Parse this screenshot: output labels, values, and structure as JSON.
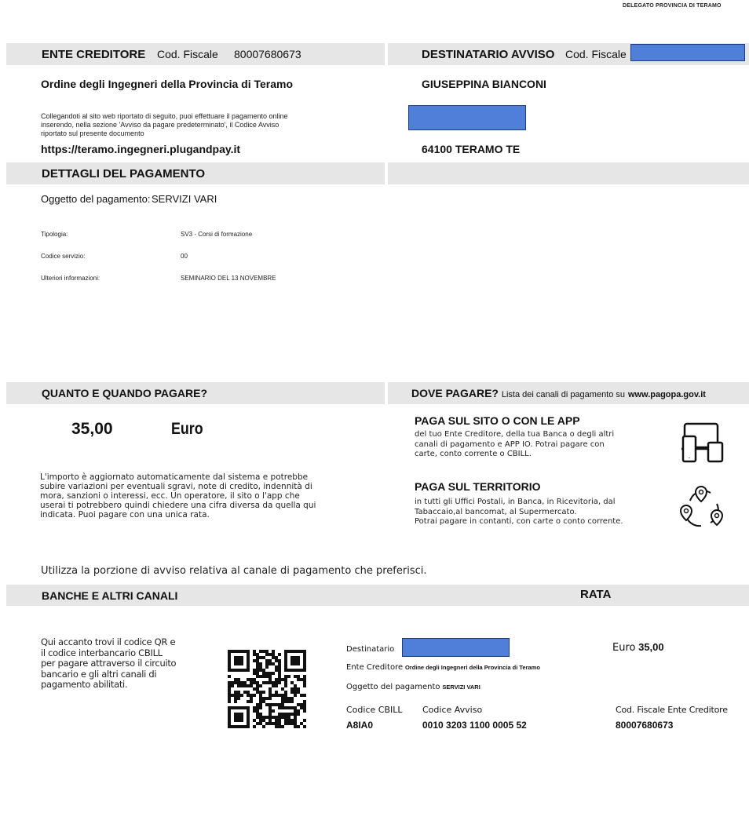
{
  "top_right_text": "DELEGATO PROVINCIA DI TERAMO",
  "creditor": {
    "header": "ENTE CREDITORE",
    "cf_label": "Cod. Fiscale",
    "cf_value": "80007680673",
    "name": "Ordine degli Ingegneri della Provincia di Teramo",
    "instructions_line1": "Collegandoti al sito web riportato di seguito, puoi effettuare il pagamento online",
    "instructions_line2": "inserendo, nella sezione 'Avviso da pagare predeterminato', il Codice Avviso",
    "instructions_line3": "riportato sul presente documento",
    "url": "https://teramo.ingegneri.plugandpay.it"
  },
  "recipient": {
    "header": "DESTINATARIO AVVISO",
    "cf_label": "Cod. Fiscale",
    "name": "GIUSEPPINA BIANCONI",
    "city": "64100 TERAMO TE"
  },
  "payment_details": {
    "header": "DETTAGLI DEL PAGAMENTO",
    "object_label": "Oggetto del pagamento:",
    "object_value": "SERVIZI VARI",
    "rows": [
      {
        "label": "Tipologia:",
        "value": "SV3 - Corsi di formazione"
      },
      {
        "label": "Codice servizio:",
        "value": "00"
      },
      {
        "label": "Ulteriori informazioni:",
        "value": "SEMINARIO DEL 13 NOVEMBRE"
      }
    ]
  },
  "how_much": {
    "header": "QUANTO E QUANDO PAGARE?",
    "amount": "35,00",
    "currency": "Euro",
    "note_lines": [
      "L'importo è aggiornato automaticamente dal sistema e potrebbe",
      "subire variazioni per eventuali sgravi, note di credito, indennità di",
      "mora, sanzioni o interessi, ecc. Un operatore, il sito o l'app che",
      "userai ti potrebbero quindi chiedere una cifra diversa da quella qui",
      "indicata. Puoi pagare con una unica rata."
    ]
  },
  "where": {
    "header": "DOVE PAGARE?",
    "header_sub": "Lista dei canali di pagamento su",
    "header_link": "www.pagopa.gov.it",
    "online_title": "PAGA SUL SITO O CON LE APP",
    "online_lines": [
      "del tuo Ente Creditore, della tua Banca o degli altri",
      "canali di pagamento e APP IO. Potrai pagare con",
      "carte, conto corrente o CBILL."
    ],
    "territory_title": "PAGA SUL TERRITORIO",
    "territory_lines": [
      "in tutti gli Uffici Postali, in Banca, in Ricevitoria, dal",
      "Tabaccaio,al bancomat, al Supermercato.",
      "Potrai pagare in contanti, con carte o conto corrente."
    ],
    "icon_devices": "devices-icon",
    "icon_map": "map-pins-icon"
  },
  "use_portion": "Utilizza la porzione di avviso relativa al canale di pagamento che preferisci.",
  "banks": {
    "header": "BANCHE E ALTRI CANALI",
    "rate_header": "RATA",
    "intro_lines": [
      "Qui accanto trovi il codice QR e",
      "il codice interbancario CBILL",
      "per pagare attraverso il circuito",
      "bancario e gli altri canali di",
      "pagamento abilitati."
    ],
    "recipient_label": "Destinatario",
    "creditor_label": "Ente Creditore",
    "creditor_value": "Ordine degli Ingegneri della Provincia di Teramo",
    "object_label": "Oggetto del pagamento",
    "object_value": "SERVIZI VARI",
    "euro_label": "Euro",
    "euro_value": "35,00",
    "cbill_label": "Codice CBILL",
    "cbill_value": "A8IA0",
    "notice_label": "Codice Avviso",
    "notice_value": "0010 3203 1100 0005 52",
    "cf_label": "Cod. Fiscale Ente Creditore",
    "cf_value": "80007680673"
  },
  "colors": {
    "band": "#e6e6e6",
    "redaction": "#4f7fd8"
  }
}
